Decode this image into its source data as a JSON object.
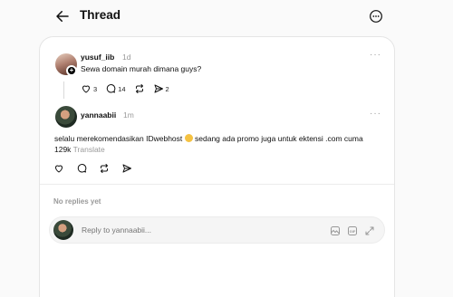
{
  "header": {
    "title": "Thread",
    "back_icon": "arrow-left-icon",
    "more_icon": "more-circle-icon"
  },
  "post": {
    "username": "yusuf_iib",
    "time": "1d",
    "text": "Sewa domain murah dimana guys?",
    "likes": "3",
    "comments": "14",
    "reposts": "",
    "shares": "2"
  },
  "reply": {
    "username": "yannaabii",
    "time": "1m",
    "text": "selalu merekomendasikan IDwebhost",
    "text_after": " sedang ada promo juga untuk ektensi .com cuma 129k",
    "translate": "Translate"
  },
  "replies_section": {
    "empty_label": "No replies yet"
  },
  "composer": {
    "placeholder": "Reply to yannaabii..."
  }
}
